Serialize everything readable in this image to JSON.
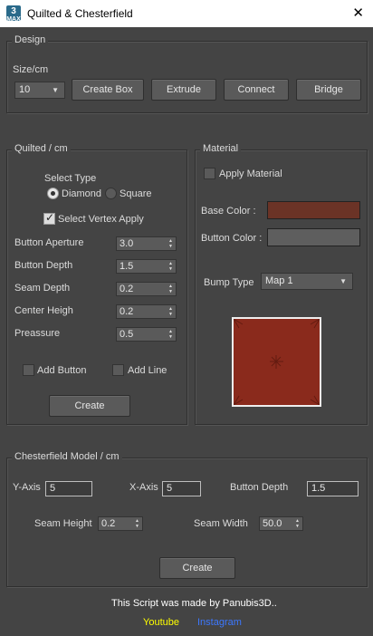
{
  "window": {
    "title": "Quilted & Chesterfield",
    "icon_label_top": "3",
    "icon_label_bottom": "MAX",
    "close_icon": "✕"
  },
  "design": {
    "group_label": "Design",
    "size_label": "Size/cm",
    "size_value": "10",
    "buttons": {
      "create_box": "Create Box",
      "extrude": "Extrude",
      "connect": "Connect",
      "bridge": "Bridge"
    }
  },
  "quilted": {
    "group_label": "Quilted / cm",
    "select_type_label": "Select Type",
    "radio_diamond": "Diamond",
    "radio_square": "Square",
    "selected_type": "Diamond",
    "select_vertex_label": "Select Vertex Apply",
    "select_vertex_checked": true,
    "fields": {
      "button_aperture_label": "Button Aperture",
      "button_aperture_value": "3.0",
      "button_depth_label": "Button Depth",
      "button_depth_value": "1.5",
      "seam_depth_label": "Seam Depth",
      "seam_depth_value": "0.2",
      "center_height_label": "Center Heigh",
      "center_height_value": "0.2",
      "preassure_label": "Preassure",
      "preassure_value": "0.5"
    },
    "add_button_label": "Add Button",
    "add_line_label": "Add Line",
    "create_label": "Create"
  },
  "material": {
    "group_label": "Material",
    "apply_material_label": "Apply Material",
    "base_color_label": "Base Color    :",
    "button_color_label": "Button Color :",
    "base_color": "#6b3326",
    "button_color": "#5e5e5e",
    "bump_type_label": "Bump Type",
    "bump_type_value": "Map 1",
    "preview_color": "#8a2a1c"
  },
  "chesterfield": {
    "group_label": "Chesterfield Model / cm",
    "y_axis_label": "Y-Axis",
    "y_axis_value": "5",
    "x_axis_label": "X-Axis",
    "x_axis_value": "5",
    "button_depth_label": "Button Depth",
    "button_depth_value": "1.5",
    "seam_height_label": "Seam Height",
    "seam_height_value": "0.2",
    "seam_width_label": "Seam Width",
    "seam_width_value": "50.0",
    "create_label": "Create"
  },
  "footer": {
    "credit": "This Script was made by Panubis3D..",
    "youtube": "Youtube",
    "instagram": "Instagram",
    "youtube_color": "#ffff00",
    "instagram_color": "#3c78ff"
  }
}
